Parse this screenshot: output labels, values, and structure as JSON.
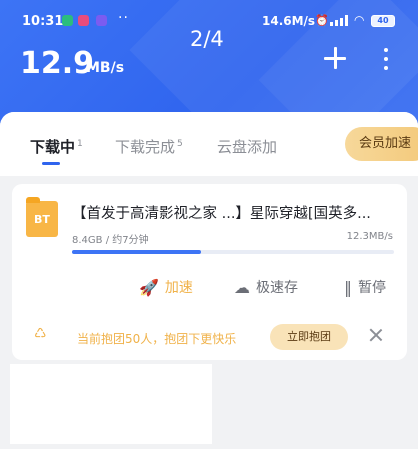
{
  "statusbar": {
    "time": "10:31",
    "dots": "··",
    "net_speed": "14.6M/s",
    "battery": "40",
    "notif_colors": [
      "#2bbd7e",
      "#e84c7d",
      "#7b5cf0"
    ]
  },
  "header": {
    "page_counter": "2/4",
    "speed_value": "12.9",
    "speed_unit": "MB/s",
    "icons": [
      "plus-icon",
      "more-vertical-icon"
    ]
  },
  "tabs": [
    {
      "label": "下载中",
      "count": "1"
    },
    {
      "label": "下载完成",
      "count": "5"
    },
    {
      "label": "云盘添加",
      "count": ""
    }
  ],
  "vip_button": "会员加速",
  "task": {
    "icon_label": "BT",
    "title": "【首发于高清影视之家 ...】星际穿越[国英多...",
    "size_eta": "8.4GB / 约7分钟",
    "rate": "12.3MB/s",
    "progress": 0.4,
    "actions": [
      {
        "label": "加速",
        "icon": "rocket-icon"
      },
      {
        "label": "极速存",
        "icon": "cloud-upload-icon"
      },
      {
        "label": "暂停",
        "icon": "pause-icon"
      }
    ]
  },
  "promo": {
    "text": "当前抱团50人，抱团下更快乐",
    "button": "立即抱团"
  },
  "colors": {
    "accent": "#2f64ee",
    "gold": "#f0b24a"
  }
}
